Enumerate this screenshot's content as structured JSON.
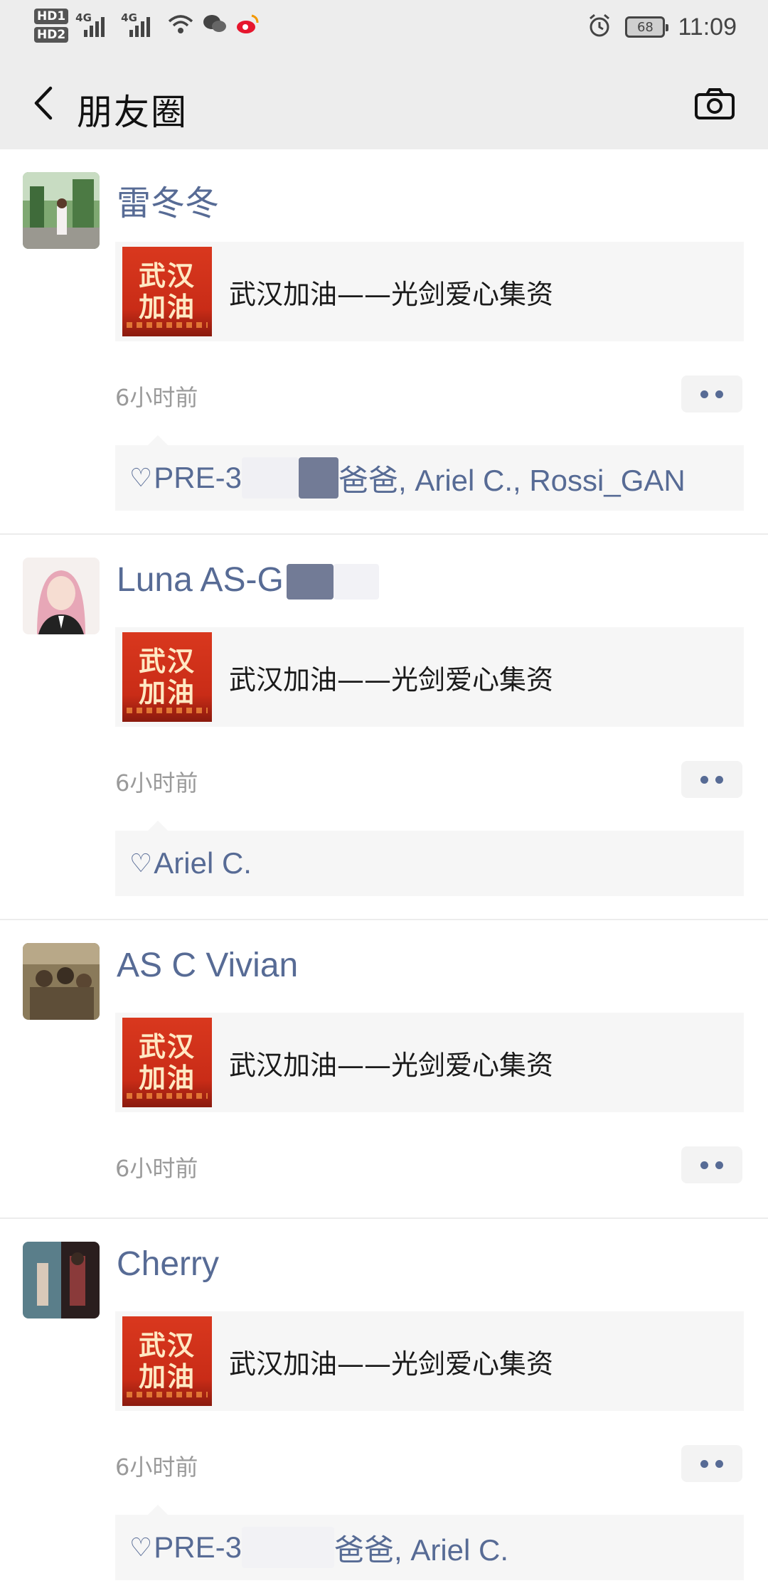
{
  "status_bar": {
    "hd1": "HD1",
    "hd2": "HD2",
    "sig1": "4G",
    "sig2": "4G",
    "battery": "68",
    "time": "11:09",
    "icons": [
      "wifi-icon",
      "wechat-icon",
      "weibo-icon",
      "alarm-icon"
    ]
  },
  "nav": {
    "title": "朋友圈",
    "back_icon": "chevron-left-icon",
    "camera_icon": "camera-icon"
  },
  "posts": [
    {
      "name": "雷冬冬",
      "link_text": "武汉加油——光剑爱心集资",
      "thumb_line1": "武汉",
      "thumb_line2": "加油",
      "time": "6小时前",
      "likes_a": "PRE-3",
      "likes_b": "爸爸, Ariel C., Rossi_GAN"
    },
    {
      "name": "Luna AS-G",
      "link_text": "武汉加油——光剑爱心集资",
      "thumb_line1": "武汉",
      "thumb_line2": "加油",
      "time": "6小时前",
      "likes_a": "Ariel C.",
      "likes_b": ""
    },
    {
      "name": "AS C Vivian",
      "link_text": "武汉加油——光剑爱心集资",
      "thumb_line1": "武汉",
      "thumb_line2": "加油",
      "time": "6小时前"
    },
    {
      "name": "Cherry",
      "link_text": "武汉加油——光剑爱心集资",
      "thumb_line1": "武汉",
      "thumb_line2": "加油",
      "time": "6小时前",
      "likes_a": "PRE-3",
      "likes_b": "爸爸, Ariel C."
    }
  ],
  "colors": {
    "link_blue": "#576b95",
    "header_bg": "#ededed",
    "card_bg": "#f6f6f6",
    "thumb_red": "#d9381e"
  }
}
